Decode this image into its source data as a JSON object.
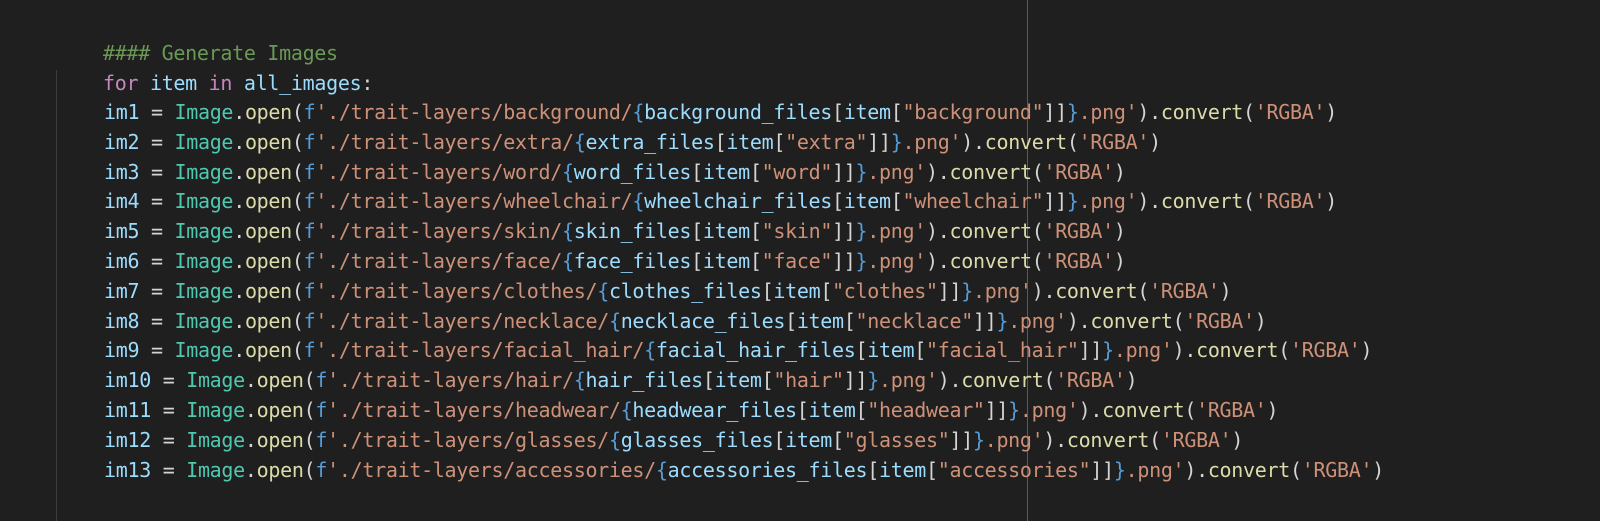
{
  "editor": {
    "theme_colors": {
      "background": "#1f1f1f",
      "comment": "#6a9955",
      "keyword": "#c586c0",
      "variable": "#9cdcfe",
      "class": "#4ec9b0",
      "function": "#dcdcaa",
      "string": "#ce9178",
      "string_prefix": "#569cd6",
      "punctuation": "#d4d4d4",
      "brace": "#569cd6"
    },
    "header": {
      "comment": "#### Generate Images",
      "for_keyword": "for",
      "loop_var": "item",
      "in_keyword": "in",
      "iterable": "all_images",
      "colon": ":"
    },
    "lines": [
      {
        "var": "im1",
        "folder": "background",
        "files": "background_files",
        "key": "background"
      },
      {
        "var": "im2",
        "folder": "extra",
        "files": "extra_files",
        "key": "extra"
      },
      {
        "var": "im3",
        "folder": "word",
        "files": "word_files",
        "key": "word"
      },
      {
        "var": "im4",
        "folder": "wheelchair",
        "files": "wheelchair_files",
        "key": "wheelchair"
      },
      {
        "var": "im5",
        "folder": "skin",
        "files": "skin_files",
        "key": "skin"
      },
      {
        "var": "im6",
        "folder": "face",
        "files": "face_files",
        "key": "face"
      },
      {
        "var": "im7",
        "folder": "clothes",
        "files": "clothes_files",
        "key": "clothes"
      },
      {
        "var": "im8",
        "folder": "necklace",
        "files": "necklace_files",
        "key": "necklace"
      },
      {
        "var": "im9",
        "folder": "facial_hair",
        "files": "facial_hair_files",
        "key": "facial_hair"
      },
      {
        "var": "im10",
        "folder": "hair",
        "files": "hair_files",
        "key": "hair"
      },
      {
        "var": "im11",
        "folder": "headwear",
        "files": "headwear_files",
        "key": "headwear"
      },
      {
        "var": "im12",
        "folder": "glasses",
        "files": "glasses_files",
        "key": "glasses"
      },
      {
        "var": "im13",
        "folder": "accessories",
        "files": "accessories_files",
        "key": "accessories"
      }
    ],
    "tokens": {
      "assign": " = ",
      "class_name": "Image",
      "dot": ".",
      "open_fn": "open",
      "paren_open": "(",
      "fprefix": "f",
      "quote": "'",
      "path_prefix": "./trait-layers/",
      "slash": "/",
      "brace_open": "{",
      "bracket_open": "[",
      "item_var": "item",
      "dquote": "\"",
      "bracket_close": "]",
      "brace_close": "}",
      "ext": ".png",
      "paren_close": ")",
      "convert_fn": "convert",
      "mode": "RGBA"
    }
  }
}
